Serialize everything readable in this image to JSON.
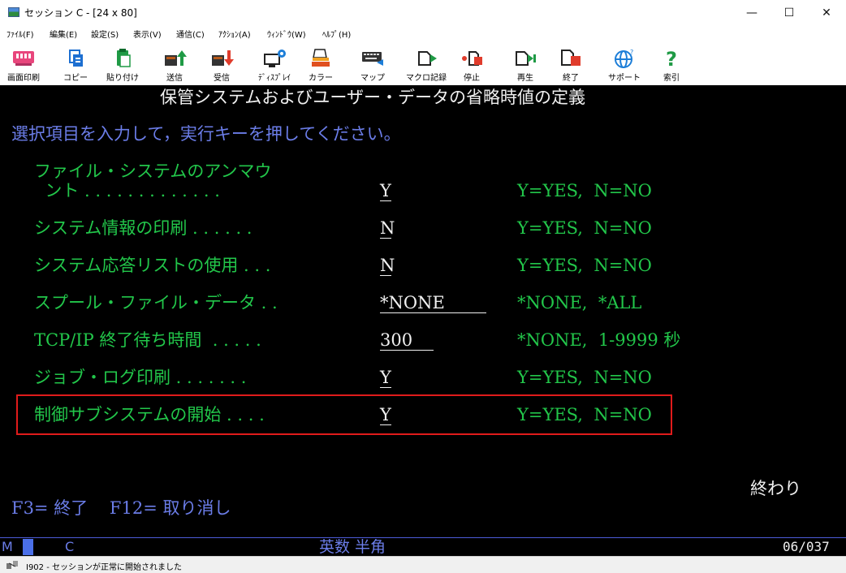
{
  "window": {
    "title": "セッション C - [24 x 80]",
    "buttons": {
      "minimize": "—",
      "maximize": "☐",
      "close": "✕"
    }
  },
  "menu": [
    "ﾌｧｲﾙ(F)",
    "編集(E)",
    "設定(S)",
    "表示(V)",
    "通信(C)",
    "ｱｸｼｮﾝ(A)",
    "ｳｨﾝﾄﾞｳ(W)",
    "ﾍﾙﾌﾟ(H)"
  ],
  "toolbar": [
    {
      "label": "画面印刷",
      "icon": "print-screen-icon"
    },
    {
      "label": "コピー",
      "icon": "copy-icon"
    },
    {
      "label": "貼り付け",
      "icon": "paste-icon"
    },
    {
      "label": "送信",
      "icon": "send-icon"
    },
    {
      "label": "受信",
      "icon": "receive-icon"
    },
    {
      "label": "ﾃﾞｨｽﾌﾟﾚｲ",
      "icon": "display-icon"
    },
    {
      "label": "カラー",
      "icon": "color-icon"
    },
    {
      "label": "マップ",
      "icon": "keyboard-map-icon"
    },
    {
      "label": "マクロ記録",
      "icon": "macro-record-icon"
    },
    {
      "label": "停止",
      "icon": "stop-icon"
    },
    {
      "label": "再生",
      "icon": "play-icon"
    },
    {
      "label": "終了",
      "icon": "exit-icon"
    },
    {
      "label": "サポート",
      "icon": "support-icon"
    },
    {
      "label": "索引",
      "icon": "help-index-icon"
    }
  ],
  "screen": {
    "title": "保管システムおよびユーザー・データの省略時値の定義",
    "instruction": "選択項目を入力して，実行キーを押してください。",
    "rows": [
      {
        "label": "ファイル・システムのアンマウ",
        "label2": "  ント . . . . . . . . . . . . .",
        "value": "Y",
        "options": "Y=YES,  N=NO"
      },
      {
        "label": "システム情報の印刷 . . . . . .",
        "value": "N",
        "options": "Y=YES,  N=NO"
      },
      {
        "label": "システム応答リストの使用 . . .",
        "value": "N",
        "options": "Y=YES,  N=NO"
      },
      {
        "label": "スプール・ファイル・データ . .",
        "value": "*NONE",
        "options": "*NONE,  *ALL"
      },
      {
        "label": "TCP/IP 終了待ち時間  . . . . .",
        "value": "300",
        "options": "*NONE,  1-9999 秒"
      },
      {
        "label": "ジョブ・ログ印刷 . . . . . . .",
        "value": "Y",
        "options": "Y=YES,  N=NO"
      },
      {
        "label": "制御サブシステムの開始 . . . .",
        "value": "Y",
        "options": "Y=YES,  N=NO"
      }
    ],
    "end_text": "終わり",
    "fkeys": "F3= 終了    F12= 取り消し"
  },
  "oia": {
    "left": "M",
    "session": "C",
    "mode": "英数 半角",
    "position": "06/037"
  },
  "status": {
    "message": "I902 - セッションが正常に開始されました"
  },
  "colors": {
    "terminal_bg": "#000000",
    "field_green": "#22c64a",
    "prompt_blue": "#6b7de8",
    "highlight_red": "#e01b1b"
  }
}
